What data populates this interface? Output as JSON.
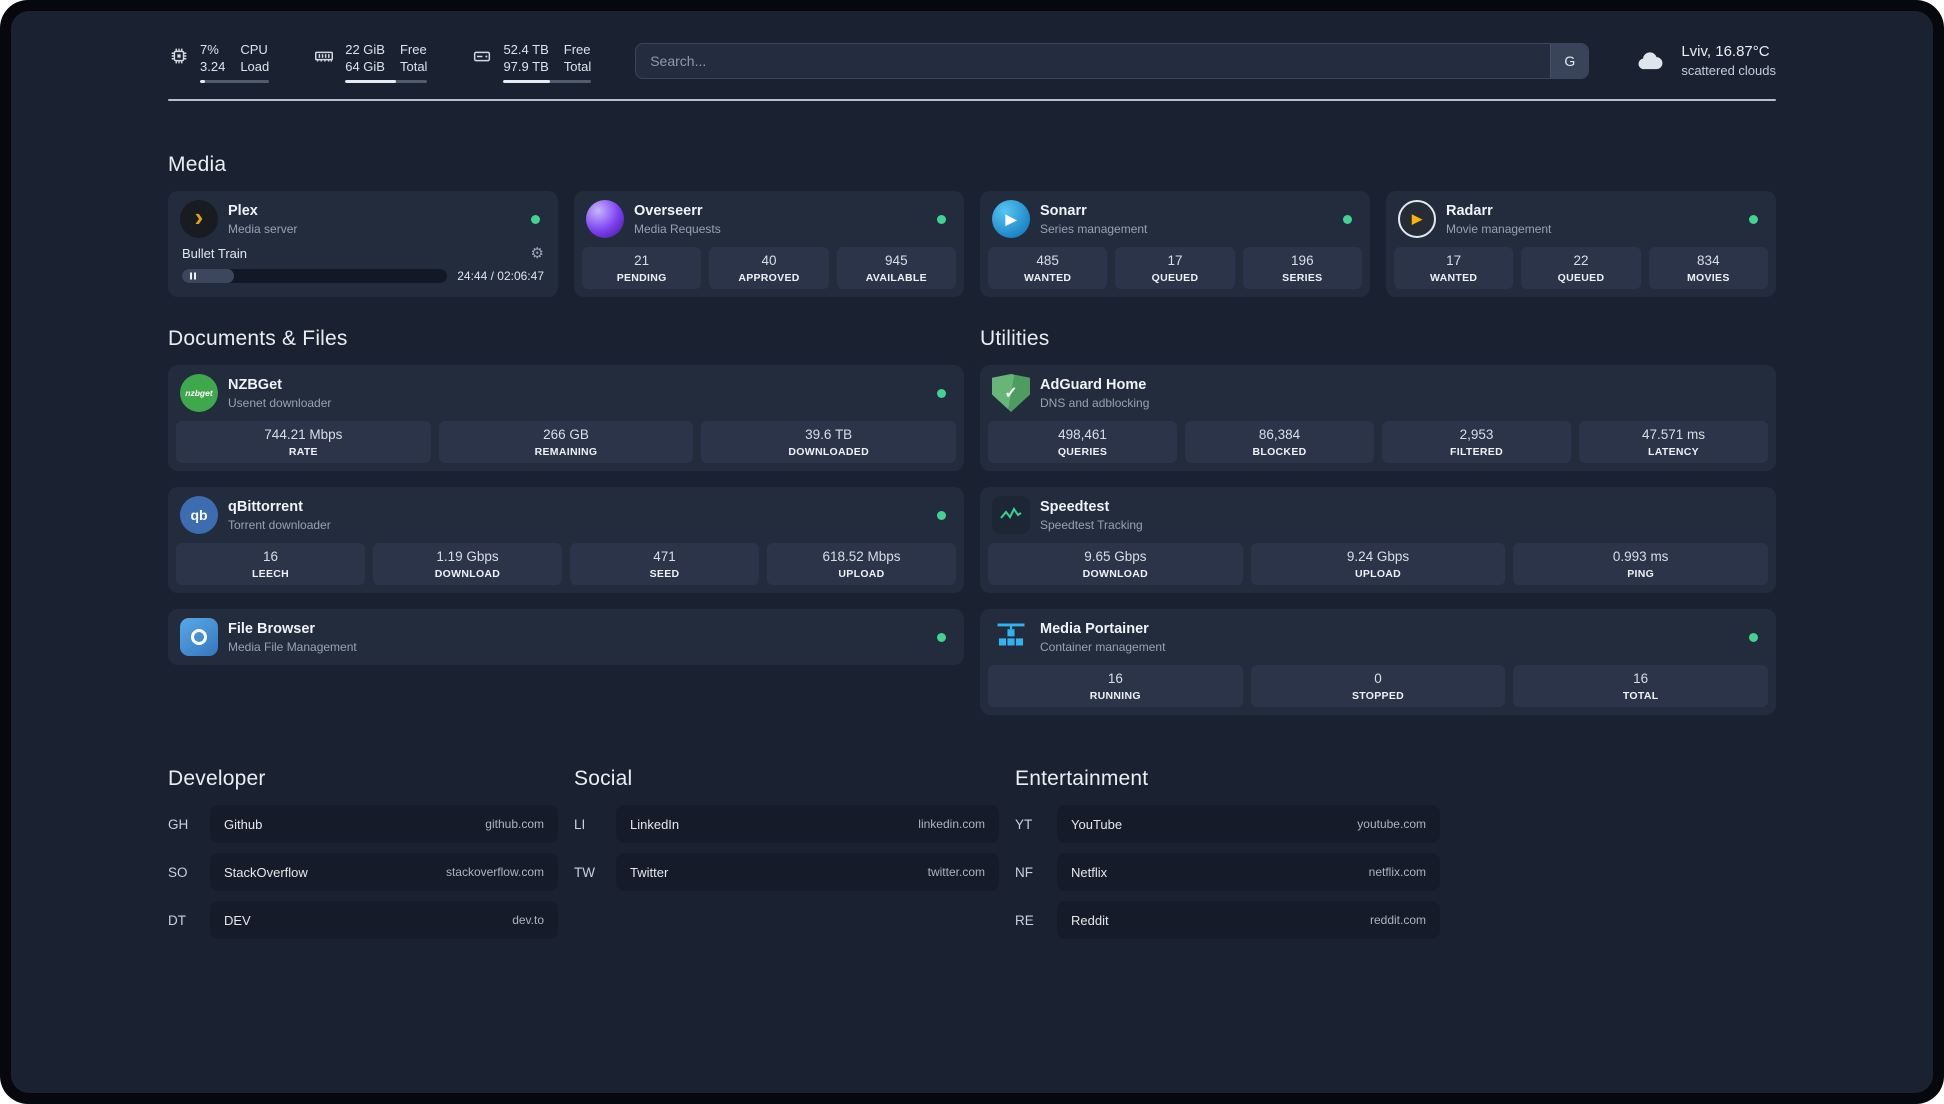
{
  "topbar": {
    "cpu": {
      "values": [
        "7%",
        "3.24"
      ],
      "labels": [
        "CPU",
        "Load"
      ],
      "usage_pct": 7
    },
    "ram": {
      "values": [
        "22 GiB",
        "64 GiB"
      ],
      "labels": [
        "Free",
        "Total"
      ],
      "usage_pct": 62
    },
    "disk": {
      "values": [
        "52.4 TB",
        "97.9 TB"
      ],
      "labels": [
        "Free",
        "Total"
      ],
      "usage_pct": 53
    },
    "search": {
      "placeholder": "Search...",
      "provider_button": "G"
    },
    "weather": {
      "location": "Lviv, 16.87°C",
      "condition": "scattered clouds"
    }
  },
  "glyphs": {
    "plex": "›",
    "sonarr": "▶",
    "radarr": "▶",
    "gear": "⚙",
    "check": "✓"
  },
  "colors": {
    "status_online": "#41d392",
    "plex_accent": "#e5a00d",
    "adguard_green": "#5fb06e",
    "portainer_blue": "#2fb4f2"
  },
  "groups": {
    "media": {
      "title": "Media",
      "plex": {
        "name": "Plex",
        "subtitle": "Media server",
        "now_playing": "Bullet Train",
        "time": "24:44 / 02:06:47",
        "progress_pct": 19.5
      },
      "overseerr": {
        "name": "Overseerr",
        "subtitle": "Media Requests",
        "stats": [
          {
            "value": "21",
            "label": "PENDING"
          },
          {
            "value": "40",
            "label": "APPROVED"
          },
          {
            "value": "945",
            "label": "AVAILABLE"
          }
        ]
      },
      "sonarr": {
        "name": "Sonarr",
        "subtitle": "Series management",
        "stats": [
          {
            "value": "485",
            "label": "WANTED"
          },
          {
            "value": "17",
            "label": "QUEUED"
          },
          {
            "value": "196",
            "label": "SERIES"
          }
        ]
      },
      "radarr": {
        "name": "Radarr",
        "subtitle": "Movie management",
        "stats": [
          {
            "value": "17",
            "label": "WANTED"
          },
          {
            "value": "22",
            "label": "QUEUED"
          },
          {
            "value": "834",
            "label": "MOVIES"
          }
        ]
      }
    },
    "documents": {
      "title": "Documents & Files",
      "nzbget": {
        "name": "NZBGet",
        "subtitle": "Usenet downloader",
        "icon_text": "nzbget",
        "stats": [
          {
            "value": "744.21 Mbps",
            "label": "RATE"
          },
          {
            "value": "266 GB",
            "label": "REMAINING"
          },
          {
            "value": "39.6 TB",
            "label": "DOWNLOADED"
          }
        ]
      },
      "qbittorrent": {
        "name": "qBittorrent",
        "subtitle": "Torrent downloader",
        "icon_text": "qb",
        "stats": [
          {
            "value": "16",
            "label": "LEECH"
          },
          {
            "value": "1.19 Gbps",
            "label": "DOWNLOAD"
          },
          {
            "value": "471",
            "label": "SEED"
          },
          {
            "value": "618.52 Mbps",
            "label": "UPLOAD"
          }
        ]
      },
      "filebrowser": {
        "name": "File Browser",
        "subtitle": "Media File Management"
      }
    },
    "utilities": {
      "title": "Utilities",
      "adguard": {
        "name": "AdGuard Home",
        "subtitle": "DNS and adblocking",
        "stats": [
          {
            "value": "498,461",
            "label": "QUERIES"
          },
          {
            "value": "86,384",
            "label": "BLOCKED"
          },
          {
            "value": "2,953",
            "label": "FILTERED"
          },
          {
            "value": "47.571 ms",
            "label": "LATENCY"
          }
        ]
      },
      "speedtest": {
        "name": "Speedtest",
        "subtitle": "Speedtest Tracking",
        "stats": [
          {
            "value": "9.65 Gbps",
            "label": "DOWNLOAD"
          },
          {
            "value": "9.24 Gbps",
            "label": "UPLOAD"
          },
          {
            "value": "0.993 ms",
            "label": "PING"
          }
        ]
      },
      "portainer": {
        "name": "Media Portainer",
        "subtitle": "Container management",
        "stats": [
          {
            "value": "16",
            "label": "RUNNING"
          },
          {
            "value": "0",
            "label": "STOPPED"
          },
          {
            "value": "16",
            "label": "TOTAL"
          }
        ]
      }
    },
    "bookmarks": [
      {
        "title": "Developer",
        "items": [
          {
            "abbr": "GH",
            "name": "Github",
            "url": "github.com"
          },
          {
            "abbr": "SO",
            "name": "StackOverflow",
            "url": "stackoverflow.com"
          },
          {
            "abbr": "DT",
            "name": "DEV",
            "url": "dev.to"
          }
        ]
      },
      {
        "title": "Social",
        "items": [
          {
            "abbr": "LI",
            "name": "LinkedIn",
            "url": "linkedin.com"
          },
          {
            "abbr": "TW",
            "name": "Twitter",
            "url": "twitter.com"
          }
        ]
      },
      {
        "title": "Entertainment",
        "items": [
          {
            "abbr": "YT",
            "name": "YouTube",
            "url": "youtube.com"
          },
          {
            "abbr": "NF",
            "name": "Netflix",
            "url": "netflix.com"
          },
          {
            "abbr": "RE",
            "name": "Reddit",
            "url": "reddit.com"
          }
        ]
      }
    ]
  }
}
